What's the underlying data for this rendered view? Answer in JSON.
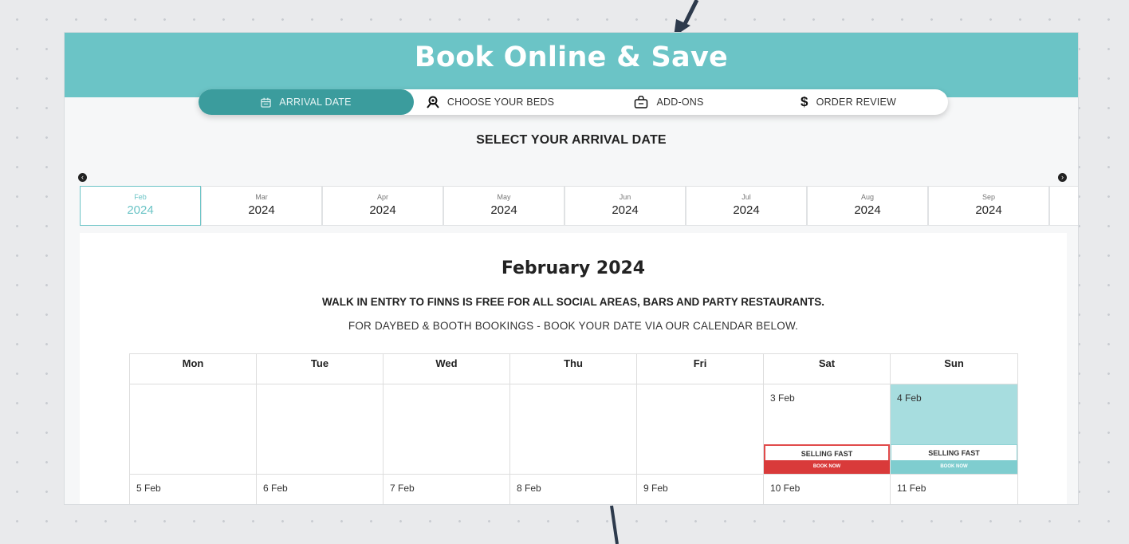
{
  "header": {
    "title": "Book Online & Save"
  },
  "steps": [
    {
      "label": "ARRIVAL DATE",
      "icon": "calendar-icon",
      "active": true
    },
    {
      "label": "CHOOSE YOUR BEDS",
      "icon": "map-pin-person-icon",
      "active": false
    },
    {
      "label": "ADD-ONS",
      "icon": "shopping-bag-icon",
      "active": false
    },
    {
      "label": "ORDER REVIEW",
      "icon": "dollar-icon",
      "active": false
    }
  ],
  "subtitle": "SELECT YOUR ARRIVAL DATE",
  "month_nav": {
    "prev_icon": "arrow-left-circle-icon",
    "next_icon": "arrow-right-circle-icon"
  },
  "months": [
    {
      "month": "Feb",
      "year": "2024",
      "active": true
    },
    {
      "month": "Mar",
      "year": "2024"
    },
    {
      "month": "Apr",
      "year": "2024"
    },
    {
      "month": "May",
      "year": "2024"
    },
    {
      "month": "Jun",
      "year": "2024"
    },
    {
      "month": "Jul",
      "year": "2024"
    },
    {
      "month": "Aug",
      "year": "2024"
    },
    {
      "month": "Sep",
      "year": "2024"
    }
  ],
  "calendar": {
    "title": "February 2024",
    "info_line_1": "WALK IN ENTRY TO FINNS IS FREE FOR ALL SOCIAL AREAS, BARS AND PARTY RESTAURANTS.",
    "info_line_2": "FOR DAYBED & BOOTH BOOKINGS - BOOK YOUR DATE VIA OUR CALENDAR BELOW.",
    "weekdays": [
      "Mon",
      "Tue",
      "Wed",
      "Thu",
      "Fri",
      "Sat",
      "Sun"
    ],
    "week1": [
      "",
      "",
      "",
      "",
      "",
      "3 Feb",
      "4 Feb"
    ],
    "week2": [
      "5 Feb",
      "6 Feb",
      "7 Feb",
      "8 Feb",
      "9 Feb",
      "10 Feb",
      "11 Feb"
    ],
    "badge_top": "SELLING FAST",
    "badge_bottom": "BOOK NOW",
    "colors": {
      "teal": "#6bc4c6",
      "dark_teal": "#3b9c9d",
      "red": "#d93a3a",
      "highlight": "#a7dddf"
    }
  }
}
